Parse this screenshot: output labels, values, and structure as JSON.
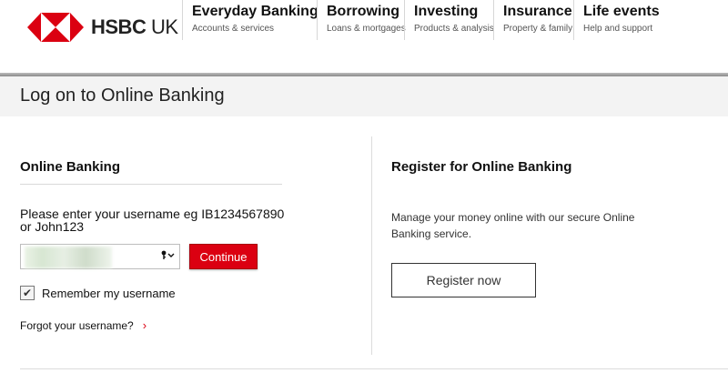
{
  "brand": {
    "name": "HSBC",
    "region": "UK",
    "logo_red": "#db0011"
  },
  "nav": {
    "items": [
      {
        "title": "Everyday Banking",
        "subtitle": "Accounts & services"
      },
      {
        "title": "Borrowing",
        "subtitle": "Loans & mortgages"
      },
      {
        "title": "Investing",
        "subtitle": "Products & analysis"
      },
      {
        "title": "Insurance",
        "subtitle": "Property & family"
      },
      {
        "title": "Life events",
        "subtitle": "Help and support"
      }
    ]
  },
  "page": {
    "title": "Log on to Online Banking"
  },
  "login": {
    "heading": "Online Banking",
    "prompt": "Please enter your username eg IB1234567890 or John123",
    "username_value": "",
    "key_icon": "key-icon",
    "continue_label": "Continue",
    "remember_label": "Remember my username",
    "remember_checked": true,
    "forgot_label": "Forgot your username?"
  },
  "register": {
    "heading": "Register for Online Banking",
    "description": "Manage your money online with our secure Online Banking service.",
    "button_label": "Register now"
  },
  "colors": {
    "accent": "#db0011",
    "title_band": "#f3f3f3"
  }
}
